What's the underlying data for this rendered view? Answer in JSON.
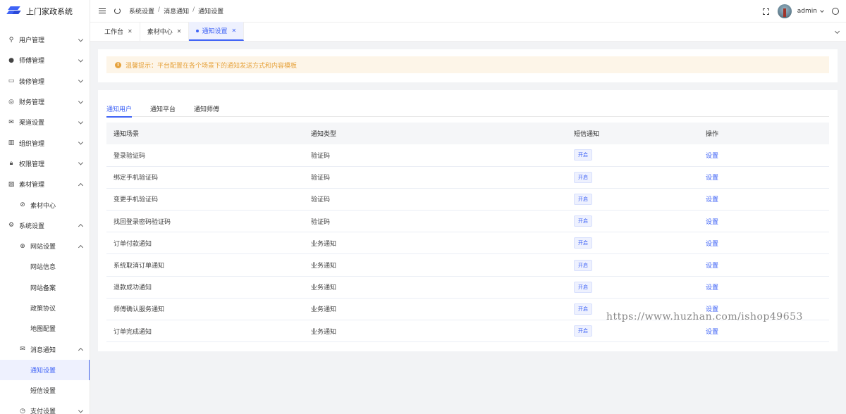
{
  "app": {
    "title": "上门家政系统",
    "accent": "#3f63f6"
  },
  "sidebar": {
    "items": [
      {
        "label": "用户管理",
        "icon": "user-icon",
        "level": 1,
        "expanded": false
      },
      {
        "label": "师傅管理",
        "icon": "worker-icon",
        "level": 1,
        "expanded": false
      },
      {
        "label": "装修管理",
        "icon": "decoration-icon",
        "level": 1,
        "expanded": false
      },
      {
        "label": "财务管理",
        "icon": "finance-icon",
        "level": 1,
        "expanded": false
      },
      {
        "label": "渠道设置",
        "icon": "channel-icon",
        "level": 1,
        "expanded": false
      },
      {
        "label": "组织管理",
        "icon": "organization-icon",
        "level": 1,
        "expanded": false
      },
      {
        "label": "权限管理",
        "icon": "lock-icon",
        "level": 1,
        "expanded": false
      },
      {
        "label": "素材管理",
        "icon": "image-icon",
        "level": 1,
        "expanded": true
      },
      {
        "label": "素材中心",
        "icon": "circle-check-icon",
        "level": 2
      },
      {
        "label": "系统设置",
        "icon": "settings-icon",
        "level": 1,
        "expanded": true
      },
      {
        "label": "网站设置",
        "icon": "globe-icon",
        "level": 2,
        "expanded": true
      },
      {
        "label": "网站信息",
        "level": 3
      },
      {
        "label": "网站备案",
        "level": 3
      },
      {
        "label": "政策协议",
        "level": 3
      },
      {
        "label": "地图配置",
        "level": 3
      },
      {
        "label": "消息通知",
        "icon": "mail-icon",
        "level": 2,
        "expanded": true
      },
      {
        "label": "通知设置",
        "level": 3,
        "active": true
      },
      {
        "label": "短信设置",
        "level": 3
      },
      {
        "label": "支付设置",
        "icon": "pay-icon",
        "level": 2,
        "expanded": false
      }
    ]
  },
  "header": {
    "breadcrumb": [
      "系统设置",
      "消息通知",
      "通知设置"
    ],
    "username": "admin"
  },
  "tabs": [
    {
      "label": "工作台",
      "active": false
    },
    {
      "label": "素材中心",
      "active": false
    },
    {
      "label": "通知设置",
      "active": true
    }
  ],
  "notice": {
    "text": "温馨提示：平台配置在各个场景下的通知发送方式和内容模板"
  },
  "subtabs": [
    "通知用户",
    "通知平台",
    "通知师傅"
  ],
  "table": {
    "headers": [
      "通知场景",
      "通知类型",
      "短信通知",
      "操作"
    ],
    "rows": [
      {
        "scene": "登录验证码",
        "type": "验证码",
        "sms": "开启",
        "action": "设置"
      },
      {
        "scene": "绑定手机验证码",
        "type": "验证码",
        "sms": "开启",
        "action": "设置"
      },
      {
        "scene": "变更手机验证码",
        "type": "验证码",
        "sms": "开启",
        "action": "设置"
      },
      {
        "scene": "找回登录密码验证码",
        "type": "验证码",
        "sms": "开启",
        "action": "设置"
      },
      {
        "scene": "订单付款通知",
        "type": "业务通知",
        "sms": "开启",
        "action": "设置"
      },
      {
        "scene": "系统取消订单通知",
        "type": "业务通知",
        "sms": "开启",
        "action": "设置"
      },
      {
        "scene": "退款成功通知",
        "type": "业务通知",
        "sms": "开启",
        "action": "设置"
      },
      {
        "scene": "师傅确认服务通知",
        "type": "业务通知",
        "sms": "开启",
        "action": "设置"
      },
      {
        "scene": "订单完成通知",
        "type": "业务通知",
        "sms": "开启",
        "action": "设置"
      }
    ]
  },
  "watermark": "https://www.huzhan.com/ishop49653"
}
